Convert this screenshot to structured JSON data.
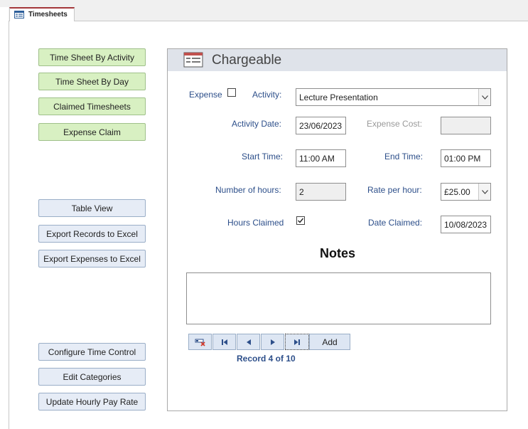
{
  "tab": {
    "title": "Timesheets",
    "icon": "form-icon"
  },
  "nav": {
    "time_sheet_by_activity": "Time Sheet By Activity",
    "time_sheet_by_day": "Time Sheet By Day",
    "claimed_timesheets": "Claimed Timesheets",
    "expense_claim": "Expense Claim",
    "table_view": "Table View",
    "export_records": "Export Records to Excel",
    "export_expenses": "Export Expenses to Excel",
    "configure_time_control": "Configure Time Control",
    "edit_categories": "Edit Categories",
    "update_hourly_pay_rate": "Update Hourly Pay Rate"
  },
  "form": {
    "title": "Chargeable",
    "expense_label": "Expense",
    "expense_checked": false,
    "activity_label": "Activity:",
    "activity_value": "Lecture Presentation",
    "activity_date_label": "Activity Date:",
    "activity_date_value": "23/06/2023",
    "expense_cost_label": "Expense Cost:",
    "expense_cost_value": "",
    "start_time_label": "Start Time:",
    "start_time_value": "11:00 AM",
    "end_time_label": "End Time:",
    "end_time_value": "01:00 PM",
    "hours_label": "Number of hours:",
    "hours_value": "2",
    "rate_label": "Rate per hour:",
    "rate_value": "£25.00",
    "hours_claimed_label": "Hours Claimed",
    "hours_claimed_checked": true,
    "date_claimed_label": "Date Claimed:",
    "date_claimed_value": "10/08/2023",
    "notes_title": "Notes",
    "notes_value": ""
  },
  "record_nav": {
    "add_label": "Add",
    "record_text": "Record 4 of 10",
    "icons": [
      "delete-record-icon",
      "first-record-icon",
      "previous-record-icon",
      "next-record-icon",
      "last-record-icon"
    ]
  },
  "colors": {
    "label_blue": "#2d4f8a",
    "nav_green": "#d8f0c2",
    "nav_blue": "#e6ecf6",
    "tab_accent": "#a4373a",
    "header_gray": "#dfe3ea"
  }
}
